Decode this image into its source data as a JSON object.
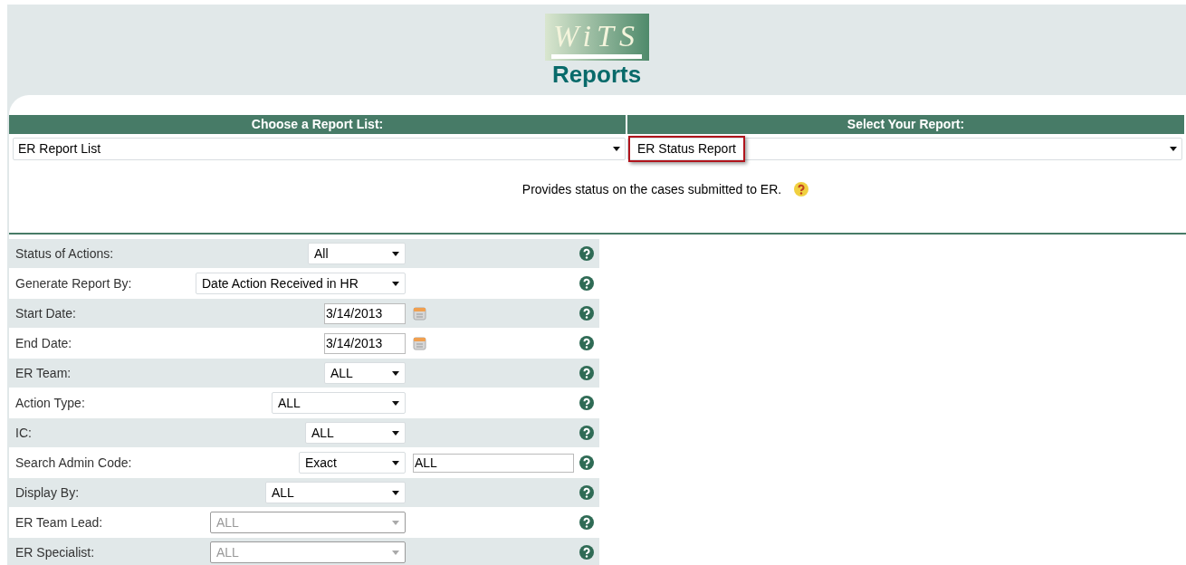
{
  "logo": {
    "text": "WiTS"
  },
  "page_title": "Reports",
  "report_list": {
    "header": "Choose a Report List:",
    "value": "ER Report List"
  },
  "report_select": {
    "header": "Select Your Report:",
    "value": "ER Status Report",
    "highlighted": true
  },
  "description": "Provides status on the cases submitted to ER.",
  "criteria": [
    {
      "kind": "select",
      "label": "Status of Actions:",
      "value": "All",
      "disabled": false
    },
    {
      "kind": "select",
      "label": "Generate Report By:",
      "value": "Date Action Received in HR",
      "disabled": false
    },
    {
      "kind": "date",
      "label": "Start Date:",
      "value": "3/14/2013",
      "disabled": false
    },
    {
      "kind": "date",
      "label": "End Date:",
      "value": "3/14/2013",
      "disabled": false
    },
    {
      "kind": "select",
      "label": "ER Team:",
      "value": "ALL",
      "disabled": false
    },
    {
      "kind": "select",
      "label": "Action Type:",
      "value": "ALL",
      "disabled": false
    },
    {
      "kind": "select",
      "label": "IC:",
      "value": "ALL",
      "disabled": false
    },
    {
      "kind": "select_text",
      "label": "Search Admin Code:",
      "value": "Exact",
      "text_value": "ALL",
      "disabled": false
    },
    {
      "kind": "select",
      "label": "Display By:",
      "value": "ALL",
      "disabled": false
    },
    {
      "kind": "select",
      "label": "ER Team Lead:",
      "value": "ALL",
      "disabled": true
    },
    {
      "kind": "select",
      "label": "ER Specialist:",
      "value": "ALL",
      "disabled": true
    }
  ]
}
